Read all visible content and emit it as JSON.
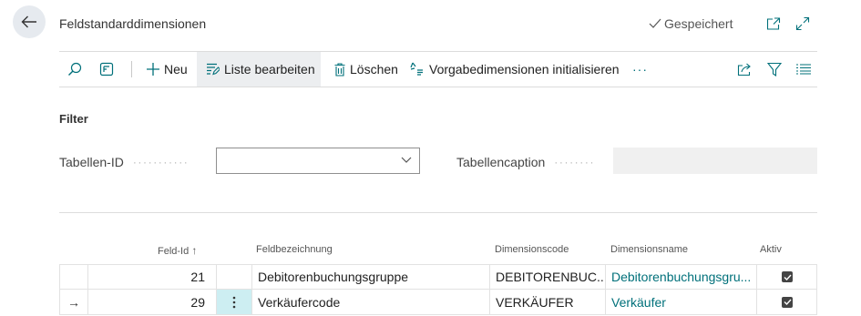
{
  "header": {
    "title": "Feldstandarddimensionen",
    "saved_status": "Gespeichert"
  },
  "toolbar": {
    "new_label": "Neu",
    "edit_list_label": "Liste bearbeiten",
    "delete_label": "Löschen",
    "init_dims_label": "Vorgabedimensionen initialisieren",
    "more_label": "···"
  },
  "filter": {
    "title": "Filter",
    "table_id_label": "Tabellen-ID",
    "table_id_value": "",
    "table_caption_label": "Tabellencaption",
    "table_caption_value": ""
  },
  "table": {
    "headers": {
      "field_id": "Feld-Id",
      "sort_indicator": "↑",
      "field_name": "Feldbezeichnung",
      "dim_code": "Dimensionscode",
      "dim_name": "Dimensionsname",
      "active": "Aktiv"
    },
    "rows": [
      {
        "indicator": "",
        "field_id": "21",
        "field_name": "Debitorenbuchungsgruppe",
        "dim_code": "DEBITORENBUC...",
        "dim_name": "Debitorenbuchungsgru...",
        "active": true
      },
      {
        "indicator": "→",
        "field_id": "29",
        "field_name": "Verkäufercode",
        "dim_code": "VERKÄUFER",
        "dim_name": "Verkäufer",
        "active": true
      }
    ]
  },
  "colors": {
    "accent": "#00707a",
    "selected_cell": "#cdeef2",
    "toolbar_active": "#eceef0"
  }
}
